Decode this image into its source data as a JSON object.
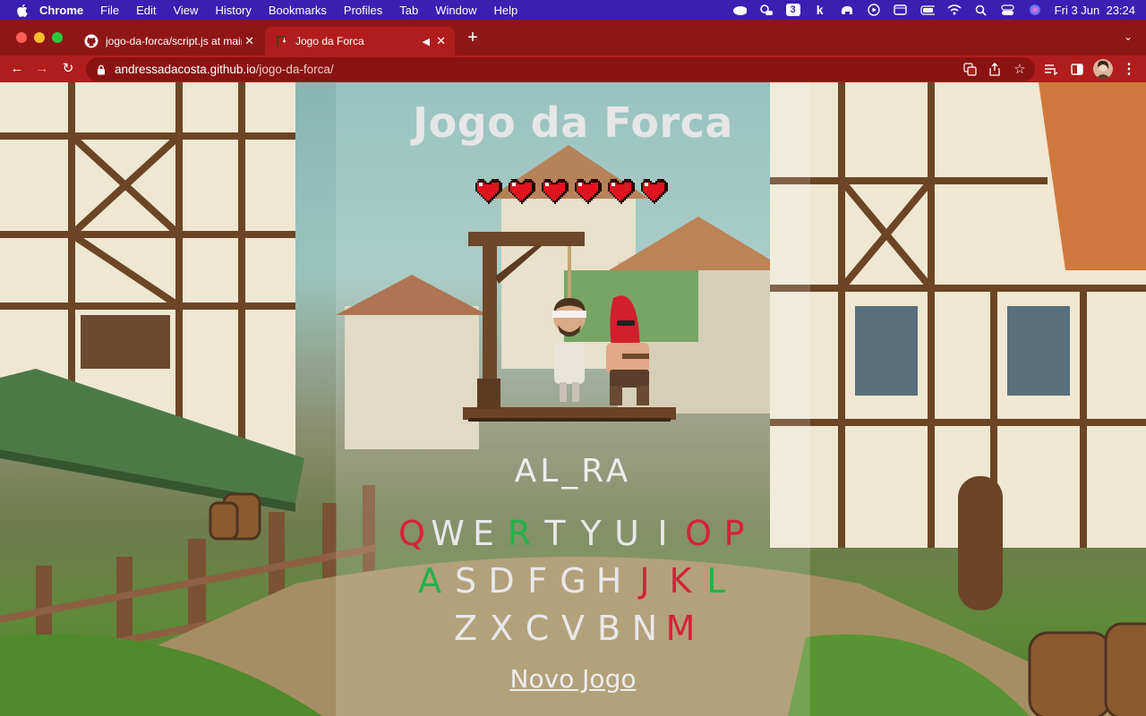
{
  "menubar": {
    "app": "Chrome",
    "items": [
      "File",
      "Edit",
      "View",
      "History",
      "Bookmarks",
      "Profiles",
      "Tab",
      "Window",
      "Help"
    ],
    "badge_number": "3",
    "datetime": "Fri 3 Jun  23:24"
  },
  "tabs": [
    {
      "title": "jogo-da-forca/script.js at main",
      "icon": "github-icon"
    },
    {
      "title": "Jogo da Forca",
      "icon": "gallows-favicon"
    }
  ],
  "address": {
    "host": "andressadacosta.github.io",
    "path": "/jogo-da-forca/"
  },
  "game": {
    "title": "Jogo da Forca",
    "lives": 6,
    "word": "AL_RA",
    "new_game": "Novo Jogo",
    "keyboard": [
      [
        {
          "k": "Q",
          "s": "wrong"
        },
        {
          "k": "W",
          "s": ""
        },
        {
          "k": "E",
          "s": ""
        },
        {
          "k": "R",
          "s": "right"
        },
        {
          "k": "T",
          "s": ""
        },
        {
          "k": "Y",
          "s": ""
        },
        {
          "k": "U",
          "s": ""
        },
        {
          "k": "I",
          "s": ""
        },
        {
          "k": "O",
          "s": "wrong"
        },
        {
          "k": "P",
          "s": "wrong"
        }
      ],
      [
        {
          "k": "A",
          "s": "right"
        },
        {
          "k": "S",
          "s": ""
        },
        {
          "k": "D",
          "s": ""
        },
        {
          "k": "F",
          "s": ""
        },
        {
          "k": "G",
          "s": ""
        },
        {
          "k": "H",
          "s": ""
        },
        {
          "k": "J",
          "s": "wrong"
        },
        {
          "k": "K",
          "s": "wrong"
        },
        {
          "k": "L",
          "s": "right"
        }
      ],
      [
        {
          "k": "Z",
          "s": ""
        },
        {
          "k": "X",
          "s": ""
        },
        {
          "k": "C",
          "s": ""
        },
        {
          "k": "V",
          "s": ""
        },
        {
          "k": "B",
          "s": ""
        },
        {
          "k": "N",
          "s": ""
        },
        {
          "k": "M",
          "s": "wrong"
        }
      ]
    ]
  },
  "colors": {
    "wrong": "#d8203a",
    "right": "#22b14c",
    "heart": "#e0141e",
    "chrome_frame": "#8f1616"
  }
}
